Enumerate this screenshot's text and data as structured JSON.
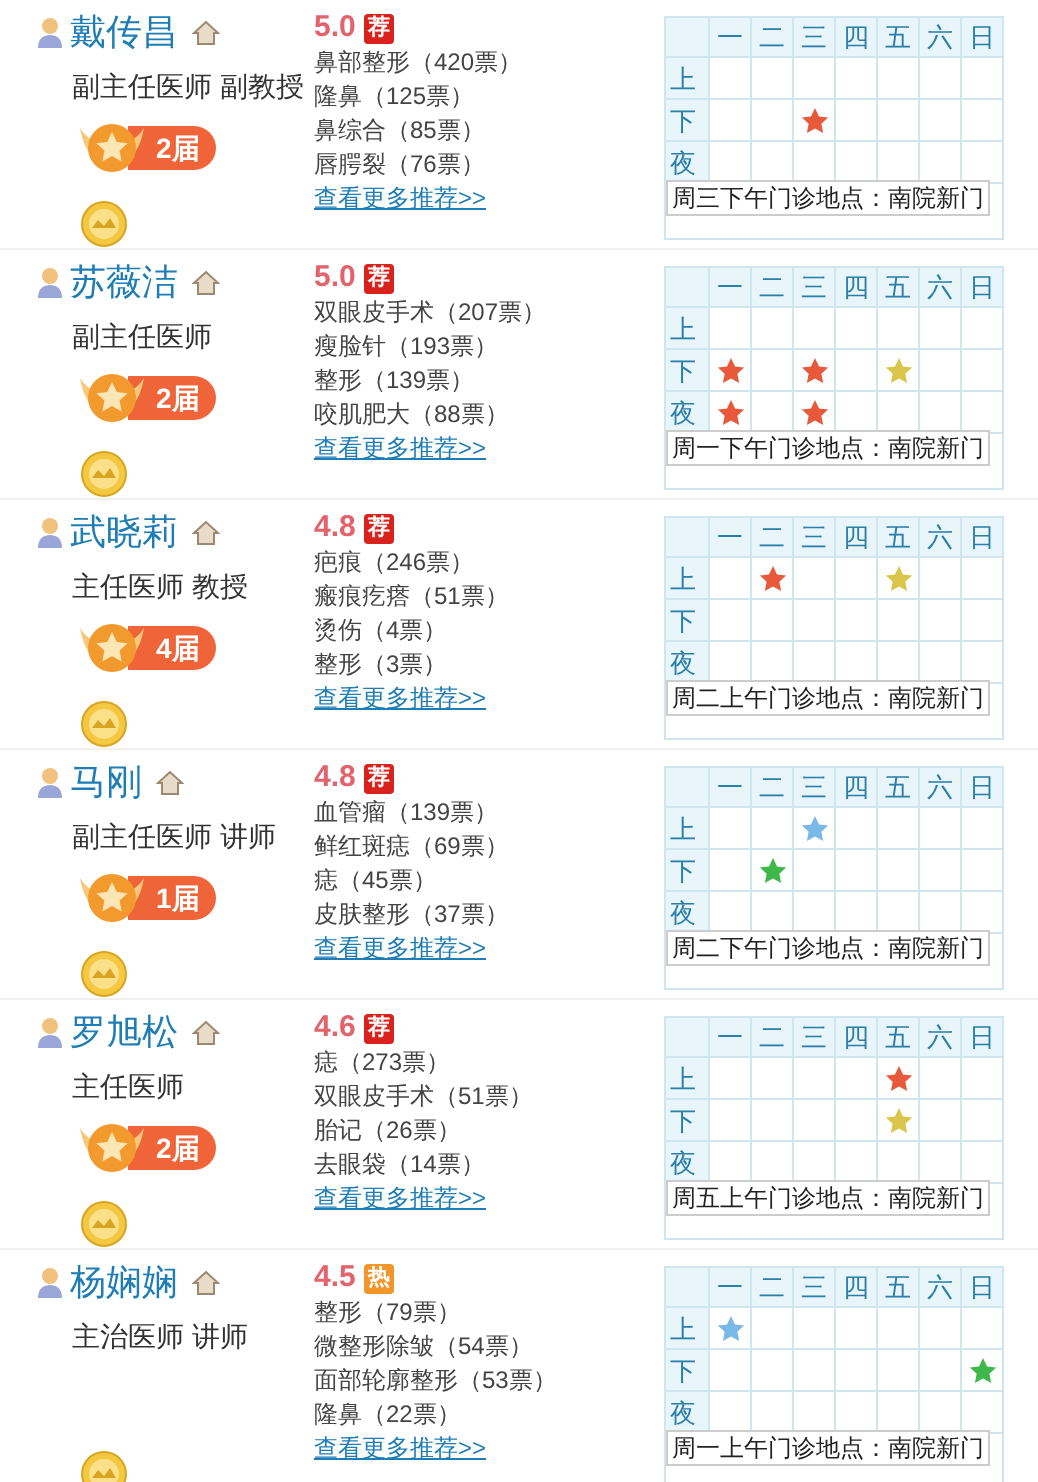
{
  "doctors": [
    {
      "name": "戴传昌",
      "title": "副主任医师 副教授",
      "award": "2届",
      "rating": "5.0",
      "tag": {
        "kind": "recommend",
        "text": "荐"
      },
      "votes": [
        "鼻部整形（420票）",
        "隆鼻（125票）",
        "鼻综合（85票）",
        "唇腭裂（76票）"
      ],
      "more_link": "查看更多推荐>>",
      "days": [
        "一",
        "二",
        "三",
        "四",
        "五",
        "六",
        "日"
      ],
      "schedule": [
        {
          "label": "上",
          "cells": [
            {
              "kind": "empty"
            },
            {
              "kind": "empty"
            },
            {
              "kind": "empty"
            },
            {
              "kind": "empty"
            },
            {
              "kind": "empty"
            },
            {
              "kind": "empty"
            },
            {
              "kind": "empty"
            }
          ]
        },
        {
          "label": "下",
          "cells": [
            {
              "kind": "empty"
            },
            {
              "kind": "empty"
            },
            {
              "kind": "star",
              "color": "#e8583a"
            },
            {
              "kind": "empty"
            },
            {
              "kind": "empty"
            },
            {
              "kind": "empty"
            },
            {
              "kind": "empty"
            }
          ]
        },
        {
          "label": "夜",
          "cells": [
            {
              "kind": "empty"
            },
            {
              "kind": "empty"
            },
            {
              "kind": "empty"
            },
            {
              "kind": "empty"
            },
            {
              "kind": "empty"
            },
            {
              "kind": "empty"
            },
            {
              "kind": "empty"
            }
          ]
        }
      ],
      "tooltip": "周三下午门诊地点：南院新门"
    },
    {
      "name": "苏薇洁",
      "title": "副主任医师",
      "award": "2届",
      "rating": "5.0",
      "tag": {
        "kind": "recommend",
        "text": "荐"
      },
      "votes": [
        "双眼皮手术（207票）",
        "瘦脸针（193票）",
        "整形（139票）",
        "咬肌肥大（88票）"
      ],
      "more_link": "查看更多推荐>>",
      "days": [
        "一",
        "二",
        "三",
        "四",
        "五",
        "六",
        "日"
      ],
      "schedule": [
        {
          "label": "上",
          "cells": [
            {
              "kind": "empty"
            },
            {
              "kind": "empty"
            },
            {
              "kind": "empty"
            },
            {
              "kind": "empty"
            },
            {
              "kind": "empty"
            },
            {
              "kind": "empty"
            },
            {
              "kind": "empty"
            }
          ]
        },
        {
          "label": "下",
          "cells": [
            {
              "kind": "star",
              "color": "#e8583a"
            },
            {
              "kind": "empty"
            },
            {
              "kind": "star",
              "color": "#e8583a"
            },
            {
              "kind": "empty"
            },
            {
              "kind": "star",
              "color": "#d9c64a"
            },
            {
              "kind": "empty"
            },
            {
              "kind": "empty"
            }
          ]
        },
        {
          "label": "夜",
          "cells": [
            {
              "kind": "star",
              "color": "#e8583a"
            },
            {
              "kind": "empty"
            },
            {
              "kind": "star",
              "color": "#e8583a"
            },
            {
              "kind": "empty"
            },
            {
              "kind": "empty"
            },
            {
              "kind": "empty"
            },
            {
              "kind": "empty"
            }
          ]
        }
      ],
      "tooltip": "周一下午门诊地点：南院新门"
    },
    {
      "name": "武晓莉",
      "title": "主任医师 教授",
      "award": "4届",
      "rating": "4.8",
      "tag": {
        "kind": "recommend",
        "text": "荐"
      },
      "votes": [
        "疤痕（246票）",
        "瘢痕疙瘩（51票）",
        "烫伤（4票）",
        "整形（3票）"
      ],
      "more_link": "查看更多推荐>>",
      "days": [
        "一",
        "二",
        "三",
        "四",
        "五",
        "六",
        "日"
      ],
      "schedule": [
        {
          "label": "上",
          "cells": [
            {
              "kind": "empty"
            },
            {
              "kind": "star",
              "color": "#e8583a"
            },
            {
              "kind": "empty"
            },
            {
              "kind": "empty"
            },
            {
              "kind": "star",
              "color": "#d9c64a"
            },
            {
              "kind": "empty"
            },
            {
              "kind": "empty"
            }
          ]
        },
        {
          "label": "下",
          "cells": [
            {
              "kind": "empty"
            },
            {
              "kind": "empty"
            },
            {
              "kind": "empty"
            },
            {
              "kind": "empty"
            },
            {
              "kind": "empty"
            },
            {
              "kind": "empty"
            },
            {
              "kind": "empty"
            }
          ]
        },
        {
          "label": "夜",
          "cells": [
            {
              "kind": "empty"
            },
            {
              "kind": "empty"
            },
            {
              "kind": "empty"
            },
            {
              "kind": "empty"
            },
            {
              "kind": "empty"
            },
            {
              "kind": "empty"
            },
            {
              "kind": "empty"
            }
          ]
        }
      ],
      "tooltip": "周二上午门诊地点：南院新门"
    },
    {
      "name": "马刚",
      "title": "副主任医师 讲师",
      "award": "1届",
      "rating": "4.8",
      "tag": {
        "kind": "recommend",
        "text": "荐"
      },
      "votes": [
        "血管瘤（139票）",
        "鲜红斑痣（69票）",
        "痣（45票）",
        "皮肤整形（37票）"
      ],
      "more_link": "查看更多推荐>>",
      "days": [
        "一",
        "二",
        "三",
        "四",
        "五",
        "六",
        "日"
      ],
      "schedule": [
        {
          "label": "上",
          "cells": [
            {
              "kind": "empty"
            },
            {
              "kind": "empty"
            },
            {
              "kind": "star",
              "color": "#7ab8e8"
            },
            {
              "kind": "empty"
            },
            {
              "kind": "empty"
            },
            {
              "kind": "empty"
            },
            {
              "kind": "empty"
            }
          ]
        },
        {
          "label": "下",
          "cells": [
            {
              "kind": "empty"
            },
            {
              "kind": "star",
              "color": "#3fb84a"
            },
            {
              "kind": "empty"
            },
            {
              "kind": "empty"
            },
            {
              "kind": "empty"
            },
            {
              "kind": "empty"
            },
            {
              "kind": "empty"
            }
          ]
        },
        {
          "label": "夜",
          "cells": [
            {
              "kind": "empty"
            },
            {
              "kind": "empty"
            },
            {
              "kind": "empty"
            },
            {
              "kind": "empty"
            },
            {
              "kind": "empty"
            },
            {
              "kind": "empty"
            },
            {
              "kind": "empty"
            }
          ]
        }
      ],
      "tooltip": "周二下午门诊地点：南院新门"
    },
    {
      "name": "罗旭松",
      "title": "主任医师",
      "award": "2届",
      "rating": "4.6",
      "tag": {
        "kind": "recommend",
        "text": "荐"
      },
      "votes": [
        "痣（273票）",
        "双眼皮手术（51票）",
        "胎记（26票）",
        "去眼袋（14票）"
      ],
      "more_link": "查看更多推荐>>",
      "days": [
        "一",
        "二",
        "三",
        "四",
        "五",
        "六",
        "日"
      ],
      "schedule": [
        {
          "label": "上",
          "cells": [
            {
              "kind": "empty"
            },
            {
              "kind": "empty"
            },
            {
              "kind": "empty"
            },
            {
              "kind": "empty"
            },
            {
              "kind": "star",
              "color": "#e8583a"
            },
            {
              "kind": "empty"
            },
            {
              "kind": "empty"
            }
          ]
        },
        {
          "label": "下",
          "cells": [
            {
              "kind": "empty"
            },
            {
              "kind": "empty"
            },
            {
              "kind": "empty"
            },
            {
              "kind": "empty"
            },
            {
              "kind": "star",
              "color": "#d9c64a"
            },
            {
              "kind": "empty"
            },
            {
              "kind": "empty"
            }
          ]
        },
        {
          "label": "夜",
          "cells": [
            {
              "kind": "empty"
            },
            {
              "kind": "empty"
            },
            {
              "kind": "empty"
            },
            {
              "kind": "empty"
            },
            {
              "kind": "empty"
            },
            {
              "kind": "empty"
            },
            {
              "kind": "empty"
            }
          ]
        }
      ],
      "tooltip": "周五上午门诊地点：南院新门"
    },
    {
      "name": "杨娴娴",
      "title": "主治医师 讲师",
      "rating": "4.5",
      "tag": {
        "kind": "hot",
        "text": "热"
      },
      "votes": [
        "整形（79票）",
        "微整形除皱（54票）",
        "面部轮廓整形（53票）",
        "隆鼻（22票）"
      ],
      "more_link": "查看更多推荐>>",
      "days": [
        "一",
        "二",
        "三",
        "四",
        "五",
        "六",
        "日"
      ],
      "schedule": [
        {
          "label": "上",
          "cells": [
            {
              "kind": "star",
              "color": "#7ab8e8"
            },
            {
              "kind": "empty"
            },
            {
              "kind": "empty"
            },
            {
              "kind": "empty"
            },
            {
              "kind": "empty"
            },
            {
              "kind": "empty"
            },
            {
              "kind": "empty"
            }
          ]
        },
        {
          "label": "下",
          "cells": [
            {
              "kind": "empty"
            },
            {
              "kind": "empty"
            },
            {
              "kind": "empty"
            },
            {
              "kind": "empty"
            },
            {
              "kind": "empty"
            },
            {
              "kind": "empty"
            },
            {
              "kind": "star",
              "color": "#3fb84a"
            }
          ]
        },
        {
          "label": "夜",
          "cells": [
            {
              "kind": "empty"
            },
            {
              "kind": "empty"
            },
            {
              "kind": "empty"
            },
            {
              "kind": "empty"
            },
            {
              "kind": "empty"
            },
            {
              "kind": "empty"
            },
            {
              "kind": "empty"
            }
          ]
        }
      ],
      "tooltip": "周一上午门诊地点：南院新门"
    }
  ]
}
